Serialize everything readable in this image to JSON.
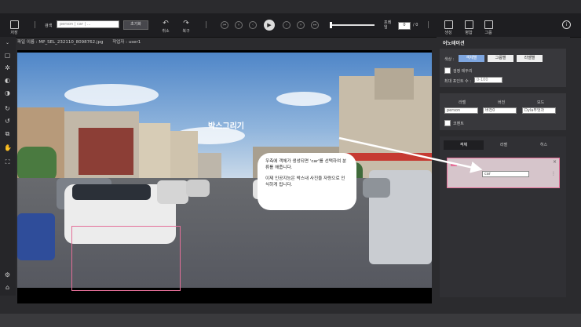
{
  "toolbar": {
    "save_label": "저장",
    "search_label": "검색",
    "search_placeholder": "person | car | ...",
    "reset_label": "초기화",
    "undo_label": "취소",
    "redo_label": "복구",
    "frame_label": "프레임",
    "frame_value": "0",
    "frame_total": "/ 0",
    "generate_label": "생성",
    "merge_label": "병합",
    "group_label": "그룹",
    "info_symbol": "i"
  },
  "file": {
    "name_label": "파일 이름 : MP_SEL_232110_8098762.jpg",
    "worker_label": "작업자 : user1"
  },
  "canvas": {
    "title": "박스그리기",
    "tooltip_line1": "우측에 객체가 생성되면 'car'를 선택하여 분류를 해줍니다.",
    "tooltip_line2": "이제 인공지능은 박스내 사진을 자량으로 인식하게 됩니다."
  },
  "annotation": {
    "title": "어노테이션",
    "color_label": "색상 :",
    "color_buttons": [
      "객체별",
      "그룹별",
      "라벨별"
    ],
    "hide_label": "검정 테두리",
    "max_points_label": "최대 포인트 수 :",
    "max_points_placeholder": "0-100",
    "label_header": "라벨",
    "version_header": "버전",
    "mode_header": "모드",
    "label_value": "person",
    "version_value": "버전0",
    "mode_value": "Dyla무엇과",
    "comment_label": "코멘트",
    "tabs": [
      "객체",
      "라벨",
      "히스"
    ],
    "object_select_value": "car"
  },
  "colors": {
    "accent": "#7ea6e0",
    "bbox": "#e46f98"
  }
}
